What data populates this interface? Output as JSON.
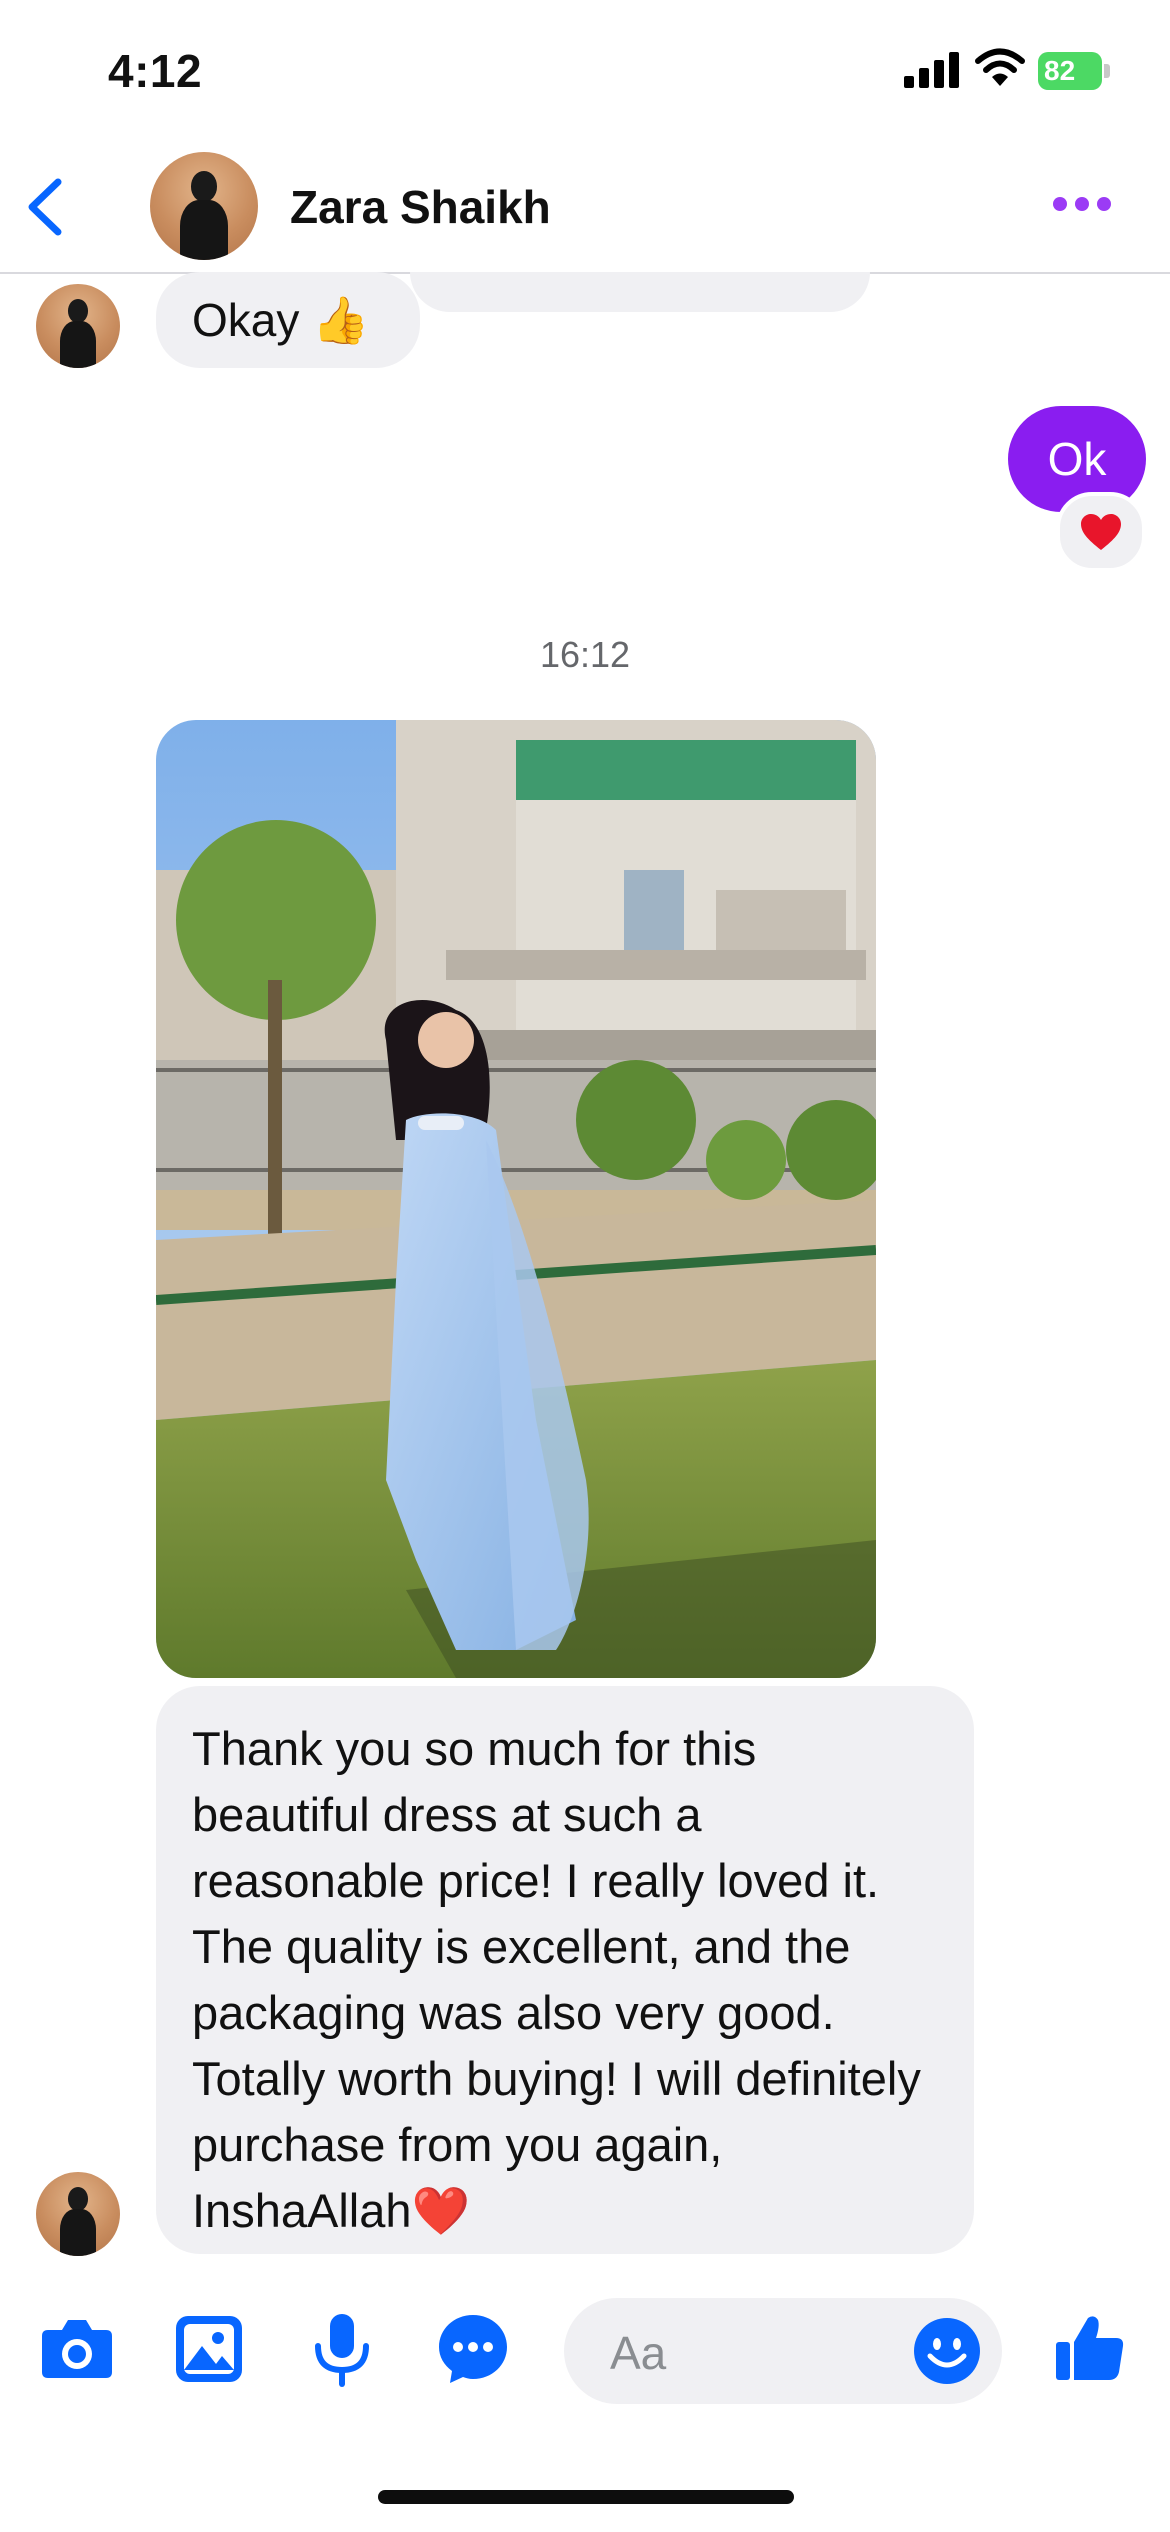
{
  "status_bar": {
    "time": "4:12",
    "battery": "82"
  },
  "header": {
    "contact_name": "Zara Shaikh"
  },
  "messages": {
    "okay": "Okay 👍",
    "ok": "Ok",
    "reaction": "❤️",
    "timestamp": "16:12",
    "long": "Thank you so much for this beautiful dress at such a reasonable price! I really loved it. The quality is excellent, and the packaging was also very good. Totally worth buying! I will definitely purchase from you again, InshaAllah❤️"
  },
  "composer": {
    "placeholder": "Aa"
  },
  "colors": {
    "accent": "#0866ff",
    "outgoing_bubble": "#8a1df0",
    "incoming_bubble": "#f0f0f3"
  }
}
